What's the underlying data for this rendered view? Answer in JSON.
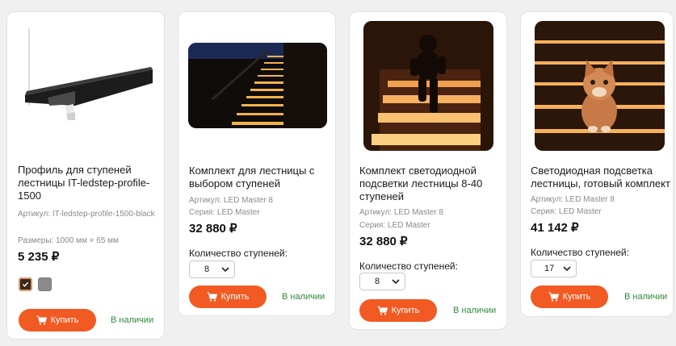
{
  "products": [
    {
      "title": "Профиль для ступеней лестницы IT-ledstep-profile-1500",
      "article": "Артикул: IT-ledstep-profile-1500-black",
      "sizes": "Размеры: 1000 мм × 65 мм",
      "price": "5 235 ₽",
      "buy_label": "Купить",
      "stock": "В наличии",
      "swatches": [
        "#3a2a1e",
        "#8a8a8a"
      ]
    },
    {
      "title": "Комплект для лестницы с выбором ступеней",
      "article": "Артикул: LED Master 8",
      "series": "Серия: LED Master",
      "price": "32 880 ₽",
      "qty_label": "Количество ступеней:",
      "qty_value": "8",
      "buy_label": "Купить",
      "stock": "В наличии"
    },
    {
      "title": "Комплект светодиодной подсветки лестницы 8-40 ступеней",
      "article": "Артикул: LED Master 8",
      "series": "Серия: LED Master",
      "price": "32 880 ₽",
      "qty_label": "Количество ступеней:",
      "qty_value": "8",
      "buy_label": "Купить",
      "stock": "В наличии"
    },
    {
      "title": "Светодиодная подсветка лестницы, готовый комплект",
      "article": "Артикул: LED Master 8",
      "series": "Серия: LED Master",
      "price": "41 142 ₽",
      "qty_label": "Количество ступеней:",
      "qty_value": "17",
      "buy_label": "Купить",
      "stock": "В наличии"
    }
  ],
  "colors": {
    "accent": "#f15a22",
    "in_stock": "#2e8b3a",
    "meta": "#8a8a8a"
  },
  "icons": {
    "buy": "cart-icon",
    "select": "chevron-down-icon",
    "swatch_selected": "checkmark-icon"
  }
}
